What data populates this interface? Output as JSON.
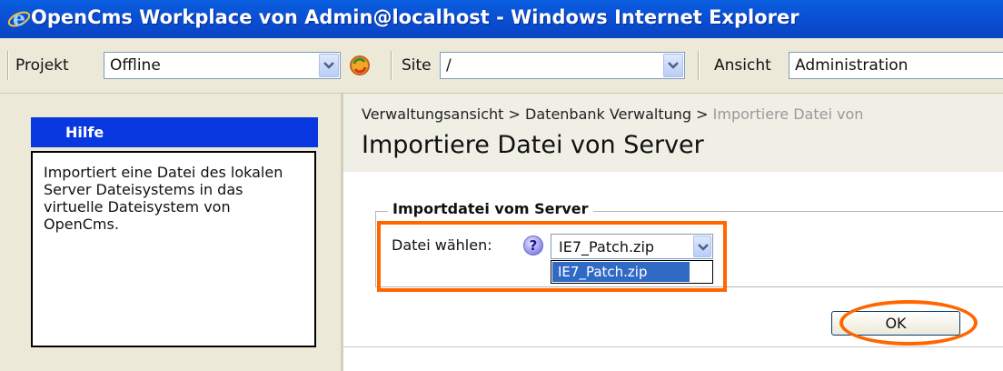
{
  "window": {
    "title": "OpenCms Workplace von Admin@localhost - Windows Internet Explorer"
  },
  "toolbar": {
    "projekt_label": "Projekt",
    "projekt_value": "Offline",
    "site_label": "Site",
    "site_value": "/",
    "ansicht_label": "Ansicht",
    "ansicht_value": "Administration"
  },
  "help": {
    "title": "Hilfe",
    "text": "Importiert eine Datei des lokalen Server Dateisystems in das virtuelle Dateisystem von OpenCms."
  },
  "breadcrumb": {
    "item1": "Verwaltungsansicht",
    "sep": ">",
    "item2": "Datenbank Verwaltung",
    "item3": "Importiere Datei von"
  },
  "page": {
    "title": "Importiere Datei von Server"
  },
  "import": {
    "legend": "Importdatei vom Server",
    "label": "Datei wählen:",
    "help_glyph": "?",
    "selected": "IE7_Patch.zip",
    "options": [
      "IE7_Patch.zip"
    ]
  },
  "actions": {
    "ok_label": "OK"
  },
  "colors": {
    "highlight": "#ff6600",
    "title_bar": "#0a4fd4",
    "help_header": "#0a38e0"
  }
}
